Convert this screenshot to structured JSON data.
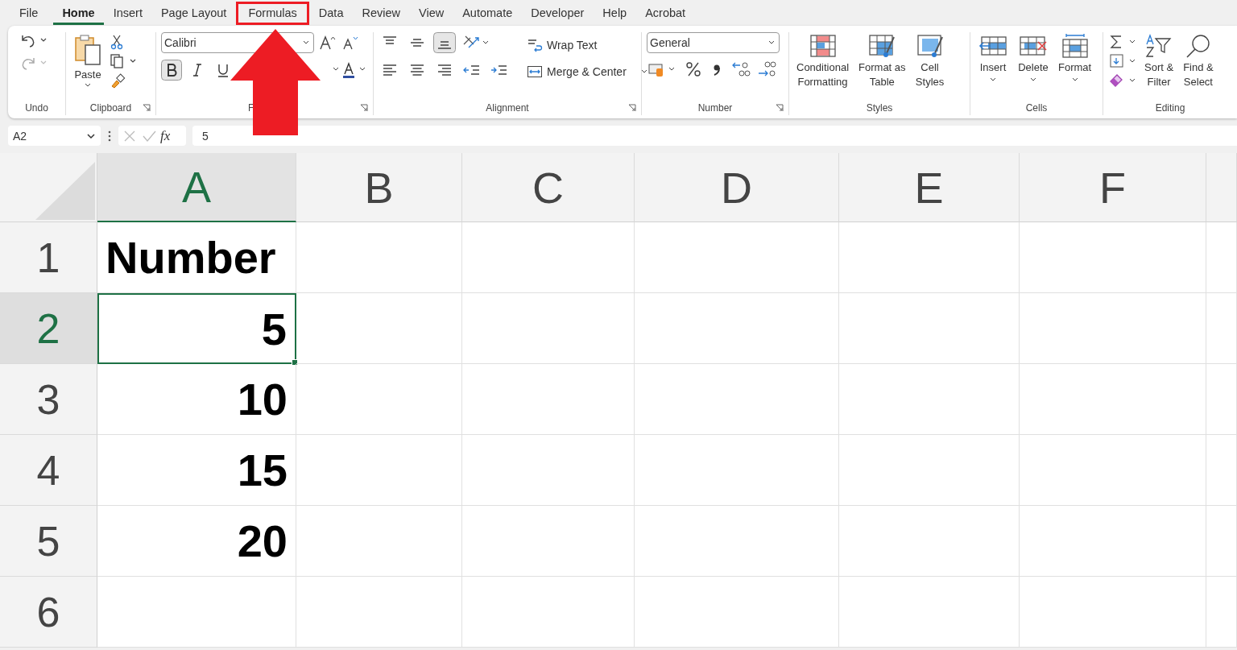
{
  "tabs": [
    {
      "label": "File",
      "selected": false,
      "annotated": false
    },
    {
      "label": "Home",
      "selected": true,
      "annotated": false
    },
    {
      "label": "Insert",
      "selected": false,
      "annotated": false
    },
    {
      "label": "Page Layout",
      "selected": false,
      "annotated": false
    },
    {
      "label": "Formulas",
      "selected": false,
      "annotated": true
    },
    {
      "label": "Data",
      "selected": false,
      "annotated": false
    },
    {
      "label": "Review",
      "selected": false,
      "annotated": false
    },
    {
      "label": "View",
      "selected": false,
      "annotated": false
    },
    {
      "label": "Automate",
      "selected": false,
      "annotated": false
    },
    {
      "label": "Developer",
      "selected": false,
      "annotated": false
    },
    {
      "label": "Help",
      "selected": false,
      "annotated": false
    },
    {
      "label": "Acrobat",
      "selected": false,
      "annotated": false
    }
  ],
  "ribbon": {
    "undo": {
      "label": "Undo"
    },
    "clipboard": {
      "label": "Clipboard",
      "paste": "Paste"
    },
    "font": {
      "label": "F",
      "font_name": "Calibri",
      "bold": true,
      "italic": false,
      "underline": false
    },
    "alignment": {
      "label": "Alignment",
      "vertical": [
        {
          "kind": "top",
          "selected": false
        },
        {
          "kind": "middle",
          "selected": false
        },
        {
          "kind": "bottom",
          "selected": true
        }
      ],
      "horizontal": [
        {
          "kind": "left",
          "selected": false
        },
        {
          "kind": "center",
          "selected": false
        },
        {
          "kind": "right",
          "selected": false
        }
      ],
      "wrap_text": "Wrap Text",
      "merge": "Merge & Center"
    },
    "number": {
      "label": "Number",
      "format": "General"
    },
    "styles": {
      "label": "Styles",
      "buttons": [
        {
          "kind": "conditional",
          "lines": [
            "Conditional",
            "Formatting"
          ]
        },
        {
          "kind": "table",
          "lines": [
            "Format as",
            "Table"
          ]
        },
        {
          "kind": "cellstyles",
          "lines": [
            "Cell",
            "Styles"
          ]
        }
      ]
    },
    "cells": {
      "label": "Cells",
      "buttons": [
        {
          "kind": "insert",
          "label": "Insert"
        },
        {
          "kind": "delete",
          "label": "Delete"
        },
        {
          "kind": "format",
          "label": "Format"
        }
      ]
    },
    "editing": {
      "label": "Editing",
      "buttons": [
        {
          "kind": "sort",
          "lines": [
            "Sort &",
            "Filter"
          ]
        },
        {
          "kind": "find",
          "lines": [
            "Find &",
            "Select"
          ]
        }
      ]
    }
  },
  "formula_bar": {
    "name_box": "A2",
    "function_label": "fx",
    "value": "5"
  },
  "sheet": {
    "columns": [
      {
        "label": "A",
        "selected": true
      },
      {
        "label": "B",
        "selected": false
      },
      {
        "label": "C",
        "selected": false
      },
      {
        "label": "D",
        "selected": false
      },
      {
        "label": "E",
        "selected": false
      },
      {
        "label": "F",
        "selected": false
      }
    ],
    "rows": [
      {
        "label": "1",
        "selected": false,
        "cells": [
          {
            "kind": "text",
            "value": "Number",
            "active": false
          }
        ]
      },
      {
        "label": "2",
        "selected": true,
        "cells": [
          {
            "kind": "number",
            "value": "5",
            "active": true
          }
        ]
      },
      {
        "label": "3",
        "selected": false,
        "cells": [
          {
            "kind": "number",
            "value": "10",
            "active": false
          }
        ]
      },
      {
        "label": "4",
        "selected": false,
        "cells": [
          {
            "kind": "number",
            "value": "15",
            "active": false
          }
        ]
      },
      {
        "label": "5",
        "selected": false,
        "cells": [
          {
            "kind": "number",
            "value": "20",
            "active": false
          }
        ]
      },
      {
        "label": "6",
        "selected": false,
        "cells": []
      }
    ]
  }
}
